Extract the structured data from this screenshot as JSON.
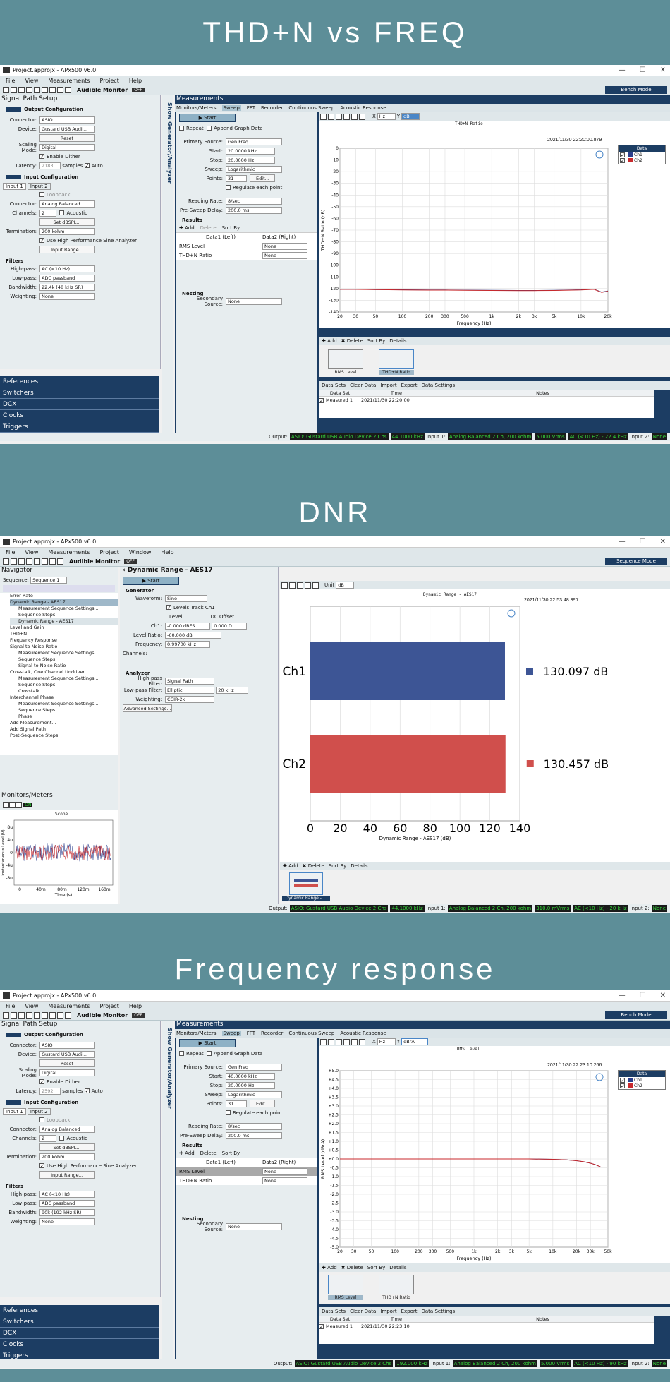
{
  "banners": {
    "one": "THD+N vs FREQ",
    "two": "DNR",
    "three": "Frequency response"
  },
  "window": {
    "title": "Project.approjx - APx500 v6.0",
    "menu_a": [
      "File",
      "View",
      "Measurements",
      "Project",
      "Help"
    ],
    "menu_b": [
      "File",
      "View",
      "Measurements",
      "Project",
      "Window",
      "Help"
    ],
    "audible_monitor": "Audible Monitor",
    "off": "OFF",
    "bench_mode": "Bench Mode",
    "sequence_mode": "Sequence Mode"
  },
  "sps": {
    "title": "Signal Path Setup",
    "output_config": "Output Configuration",
    "connector_l": "Connector:",
    "connector_v": "ASIO",
    "device_l": "Device:",
    "device_v": "Gustard USB Audi...",
    "reset": "Reset",
    "scaling_l": "Scaling Mode:",
    "scaling_v": "Digital",
    "enable_dither": "Enable Dither",
    "latency_l": "Latency:",
    "latency_v1": "2183",
    "latency_v3": "2592",
    "samples": "samples",
    "auto": "Auto",
    "input_config": "Input Configuration",
    "input1": "Input 1",
    "input2": "Input 2",
    "loopback": "Loopback",
    "in_connector_v": "Analog Balanced",
    "channels_l": "Channels:",
    "channels_v": "2",
    "acoustic": "Acoustic",
    "set_dbspl": "Set dBSPL...",
    "termination_l": "Termination:",
    "termination_v": "200 kohm",
    "high_perf": "Use High Performance Sine Analyzer",
    "input_range": "Input Range...",
    "filters": "Filters",
    "highpass_l": "High-pass:",
    "highpass_v": "AC (<10 Hz)",
    "lowpass_l": "Low-pass:",
    "lowpass_v": "ADC passband",
    "bandwidth_l": "Bandwidth:",
    "bandwidth_v1": "22.4k (48 kHz SR)",
    "bandwidth_v3": "90k (192 kHz SR)",
    "weighting_l": "Weighting:",
    "weighting_v": "None"
  },
  "nav_sections": [
    "References",
    "Switchers",
    "DCX",
    "Clocks",
    "Triggers"
  ],
  "show_gen": "Show Generator/Analyzer",
  "meas": {
    "title": "Measurements",
    "tabs": [
      "Monitors/Meters",
      "Sweep",
      "FFT",
      "Recorder",
      "Continuous Sweep",
      "Acoustic Response"
    ],
    "start": "Start",
    "repeat": "Repeat",
    "append": "Append Graph Data",
    "primary_l": "Primary Source:",
    "primary_v": "Gen Freq",
    "start_l": "Start:",
    "stop_l": "Stop:",
    "start_v1": "20.0000 kHz",
    "stop_v1": "20.0000 Hz",
    "start_v3": "40.0000 kHz",
    "stop_v3": "20.0000 Hz",
    "sweep_l": "Sweep:",
    "sweep_v": "Logarithmic",
    "points_l": "Points:",
    "points_v": "31",
    "edit": "Edit...",
    "regulate": "Regulate each point",
    "reading_l": "Reading Rate:",
    "reading_v": "8/sec",
    "presweep_l": "Pre-Sweep Delay:",
    "presweep_v": "200.0 ms",
    "results": "Results",
    "add": "Add",
    "delete": "Delete",
    "sortby": "Sort By",
    "col1": "Data1 (Left)",
    "col2": "Data2 (Right)",
    "r1": "RMS Level",
    "r2": "THD+N Ratio",
    "none": "None",
    "nesting": "Nesting",
    "secondary_l": "Secondary Source:",
    "secondary_v": "None"
  },
  "graph1": {
    "title": "THD+N Ratio",
    "timestamp": "2021/11/30 22:20:00.879",
    "xunit": "Hz",
    "yunit": "dB",
    "xlabel": "Frequency (Hz)",
    "ylabel": "THD+N Ratio (dB)"
  },
  "graph3": {
    "title": "RMS Level",
    "timestamp": "2021/11/30 22:23:10.266",
    "xunit": "Hz",
    "yunit": "dBrA",
    "xlabel": "Frequency (Hz)",
    "ylabel": "RMS Level (dBrA)"
  },
  "legend": {
    "title": "Data",
    "ch1": "Ch1",
    "ch2": "Ch2",
    "ch1_color": "#2b3f8c",
    "ch2_color": "#c8292c"
  },
  "bottom": {
    "add": "Add",
    "delete": "Delete",
    "sortby": "Sort By",
    "details": "Details",
    "thumb1": "RMS Level",
    "thumb2": "THD+N Ratio",
    "datasets": "Data Sets",
    "clear": "Clear Data",
    "import": "Import",
    "export": "Export",
    "settings": "Data Settings",
    "c_dataset": "Data Set",
    "c_time": "Time",
    "c_notes": "Notes",
    "measured": "Measured 1",
    "time1": "2021/11/30 22:20:00",
    "time3": "2021/11/30 22:23:10"
  },
  "status1": {
    "output": "Output:",
    "asio": "ASIO: Gustard USB Audio Device 2 Chs",
    "rate": "44.1000 kHz",
    "input1": "Input 1:",
    "ab": "Analog Balanced 2 Ch, 200 kohm",
    "vrms": "5.000 Vrms",
    "ac": "AC (<10 Hz) - 22.4 kHz",
    "input2": "Input 2:",
    "none": "None"
  },
  "status2": {
    "output": "Output:",
    "asio": "ASIO: Gustard USB Audio Device 2 Chs",
    "rate": "44.1000 kHz",
    "input1": "Input 1:",
    "ab": "Analog Balanced 2 Ch, 200 kohm",
    "vrms": "310.0 mVrms",
    "ac": "AC (<10 Hz) - 20 kHz",
    "input2": "Input 2:",
    "none": "None"
  },
  "status3": {
    "output": "Output:",
    "asio": "ASIO: Gustard USB Audio Device 2 Chs",
    "rate": "192.000 kHz",
    "input1": "Input 1:",
    "ab": "Analog Balanced 2 Ch, 200 kohm",
    "vrms": "5.000 Vrms",
    "ac": "AC (<10 Hz) - 90 kHz",
    "input2": "Input 2:",
    "none": "None"
  },
  "navigator": {
    "title": "Navigator",
    "seq_l": "Sequence:",
    "seq_v": "Sequence 1",
    "items": [
      "Error Rate",
      "Dynamic Range - AES17",
      "Measurement Sequence Settings...",
      "Sequence Steps",
      "Dynamic Range - AES17",
      "Level and Gain",
      "THD+N",
      "Frequency Response",
      "Signal to Noise Ratio",
      "Measurement Sequence Settings...",
      "Sequence Steps",
      "Signal to Noise Ratio",
      "Crosstalk, One Channel Undriven",
      "Measurement Sequence Settings...",
      "Sequence Steps",
      "Crosstalk",
      "Interchannel Phase",
      "Measurement Sequence Settings...",
      "Sequence Steps",
      "Phase",
      "Add Measurement...",
      "Add Signal Path",
      "Post-Sequence Steps"
    ],
    "mm_title": "Monitors/Meters",
    "on": "ON",
    "scope": "Scope",
    "scope_y": "Instantaneous Level (V)",
    "scope_x": "Time (s)",
    "scope_yt": [
      "8u",
      "4u",
      "0",
      "-4u",
      "-8u"
    ],
    "scope_xt": [
      "0",
      "40m",
      "80m",
      "120m",
      "160m"
    ]
  },
  "dnr": {
    "title": "Dynamic Range - AES17",
    "generator": "Generator",
    "waveform_l": "Waveform:",
    "waveform_v": "Sine",
    "levels_track": "Levels Track Ch1",
    "level_h": "Level",
    "dc_h": "DC Offset",
    "ch1_l": "Ch1:",
    "ch1_v": "-0.000 dBFS",
    "dc_v": "0.000 D",
    "ratio_l": "Level Ratio:",
    "ratio_v": "-60.000 dB",
    "freq_l": "Frequency:",
    "freq_v": "0.99700 kHz",
    "channels_l": "Channels:",
    "analyzer": "Analyzer",
    "hp_l": "High-pass Filter:",
    "hp_v": "Signal Path",
    "lp_l": "Low-pass Filter:",
    "lp_v": "Elliptic",
    "lp_f": "20 kHz",
    "w_l": "Weighting:",
    "w_v": "CCIR-2k",
    "adv": "Advanced Settings...",
    "unit_l": "Unit",
    "unit_v": "dB",
    "graph_title": "Dynamic Range - AES17",
    "timestamp": "2021/11/30 22:53:48.397",
    "thumb": "Dynamic Range - ..."
  },
  "chart_data": [
    {
      "type": "line",
      "title": "THD+N Ratio",
      "xlabel": "Frequency (Hz)",
      "ylabel": "THD+N Ratio (dB)",
      "x_scale": "log",
      "xlim": [
        20,
        20000
      ],
      "ylim": [
        -140,
        0
      ],
      "x_ticks": [
        "20",
        "30",
        "50",
        "100",
        "200",
        "300",
        "500",
        "1k",
        "2k",
        "3k",
        "5k",
        "10k",
        "20k"
      ],
      "y_ticks": [
        "0",
        "-10",
        "-20",
        "-30",
        "-40",
        "-50",
        "-60",
        "-70",
        "-80",
        "-90",
        "-100",
        "-110",
        "-120",
        "-130",
        "-140"
      ],
      "x": [
        20,
        30,
        50,
        100,
        200,
        300,
        500,
        1000,
        2000,
        3000,
        5000,
        10000,
        14000,
        17000,
        20000
      ],
      "series": [
        {
          "name": "Ch1",
          "color": "#2b3f8c",
          "values": [
            -120.5,
            -120.5,
            -120.8,
            -121,
            -121.2,
            -121.2,
            -121.3,
            -121.5,
            -121.6,
            -121.6,
            -121.5,
            -121,
            -120.5,
            -123,
            -122
          ]
        },
        {
          "name": "Ch2",
          "color": "#c8292c",
          "values": [
            -120.6,
            -120.6,
            -120.9,
            -121.1,
            -121.3,
            -121.3,
            -121.4,
            -121.6,
            -121.7,
            -121.7,
            -121.6,
            -121.1,
            -120.6,
            -123.2,
            -122.2
          ]
        }
      ]
    },
    {
      "type": "bar",
      "orientation": "horizontal",
      "title": "Dynamic Range - AES17",
      "xlabel": "Dynamic Range - AES17 (dB)",
      "categories": [
        "Ch1",
        "Ch2"
      ],
      "values": [
        130.097,
        130.457
      ],
      "value_labels": [
        "130.097 dB",
        "130.457 dB"
      ],
      "colors": [
        "#3d5595",
        "#d04f4c"
      ],
      "xlim": [
        0,
        140
      ],
      "x_ticks": [
        "0",
        "20",
        "40",
        "60",
        "80",
        "100",
        "120",
        "140"
      ]
    },
    {
      "type": "line",
      "title": "RMS Level",
      "xlabel": "Frequency (Hz)",
      "ylabel": "RMS Level (dBrA)",
      "x_scale": "log",
      "xlim": [
        20,
        50000
      ],
      "ylim": [
        -5,
        5
      ],
      "x_ticks": [
        "20",
        "30",
        "50",
        "100",
        "200",
        "300",
        "500",
        "1k",
        "2k",
        "3k",
        "5k",
        "10k",
        "20k",
        "30k",
        "50k"
      ],
      "y_ticks": [
        "+5.0",
        "+4.5",
        "+4.0",
        "+3.5",
        "+3.0",
        "+2.5",
        "+2.0",
        "+1.5",
        "+1.0",
        "+0.5",
        "+0.0",
        "-0.5",
        "-1.0",
        "-1.5",
        "-2.0",
        "-2.5",
        "-3.0",
        "-3.5",
        "-4.0",
        "-4.5",
        "-5.0"
      ],
      "x": [
        20,
        100,
        1000,
        5000,
        10000,
        15000,
        20000,
        25000,
        30000,
        35000,
        40000
      ],
      "series": [
        {
          "name": "Ch1",
          "color": "#2b3f8c",
          "values": [
            0,
            0,
            0,
            0,
            -0.02,
            -0.05,
            -0.1,
            -0.16,
            -0.24,
            -0.33,
            -0.44
          ]
        },
        {
          "name": "Ch2",
          "color": "#c8292c",
          "values": [
            0,
            0,
            0,
            0,
            -0.02,
            -0.05,
            -0.1,
            -0.16,
            -0.24,
            -0.33,
            -0.44
          ]
        }
      ]
    }
  ]
}
